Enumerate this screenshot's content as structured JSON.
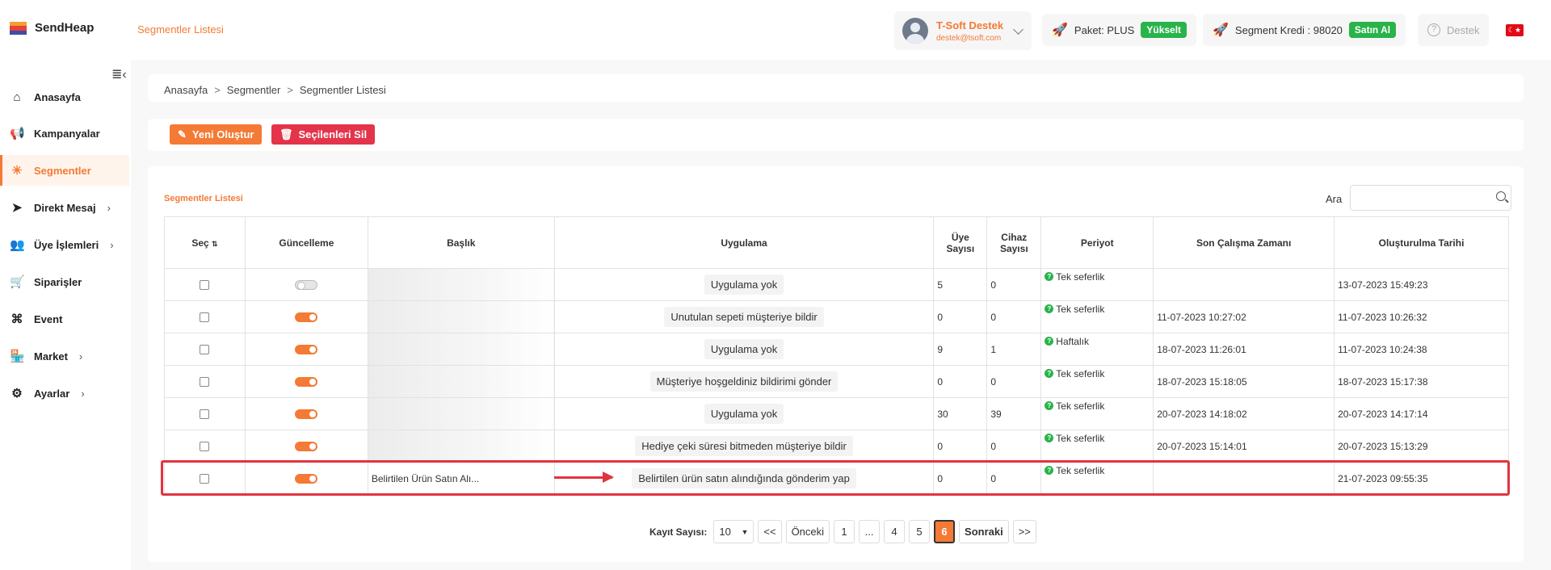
{
  "app": {
    "name": "SendHeap",
    "page_heading": "Segmentler Listesi"
  },
  "user": {
    "name": "T-Soft Destek",
    "email": "destek@tsoft.com"
  },
  "topbar": {
    "package_label": "Paket: PLUS",
    "upgrade_label": "Yükselt",
    "credit_label": "Segment Kredi : 98020",
    "buy_label": "Satın Al",
    "support_label": "Destek",
    "language": "TR"
  },
  "sidebar": {
    "items": [
      {
        "label": "Anasayfa",
        "icon": "home-icon",
        "glyph": "⌂",
        "chevron": ""
      },
      {
        "label": "Kampanyalar",
        "icon": "megaphone-icon",
        "glyph": "📢",
        "chevron": ""
      },
      {
        "label": "Segmentler",
        "icon": "segments-icon",
        "glyph": "✳",
        "chevron": ""
      },
      {
        "label": "Direkt Mesaj",
        "icon": "send-icon",
        "glyph": "➤",
        "chevron": "›"
      },
      {
        "label": "Üye İşlemleri",
        "icon": "users-icon",
        "glyph": "👥",
        "chevron": "›"
      },
      {
        "label": "Siparişler",
        "icon": "cart-icon",
        "glyph": "🛒",
        "chevron": ""
      },
      {
        "label": "Event",
        "icon": "command-icon",
        "glyph": "⌘",
        "chevron": ""
      },
      {
        "label": "Market",
        "icon": "store-icon",
        "glyph": "🏪",
        "chevron": "›"
      },
      {
        "label": "Ayarlar",
        "icon": "gear-icon",
        "glyph": "⚙",
        "chevron": "›"
      }
    ]
  },
  "breadcrumb": {
    "home": "Anasayfa",
    "parent": "Segmentler",
    "current": "Segmentler Listesi"
  },
  "actions": {
    "create": "Yeni Oluştur",
    "delete_selected": "Seçilenleri Sil"
  },
  "list": {
    "title": "Segmentler Listesi",
    "search_label": "Ara",
    "search_value": ""
  },
  "table": {
    "headers": {
      "select": "Seç",
      "update": "Güncelleme",
      "title": "Başlık",
      "application": "Uygulama",
      "members_1": "Üye",
      "members_2": "Sayısı",
      "devices_1": "Cihaz",
      "devices_2": "Sayısı",
      "period": "Periyot",
      "last_run": "Son Çalışma Zamanı",
      "created": "Oluşturulma Tarihi"
    },
    "rows": [
      {
        "toggle": "off",
        "title": "",
        "app": "Uygulama yok",
        "members": "5",
        "devices": "0",
        "period": "Tek seferlik",
        "last_run": "",
        "created": "13-07-2023 15:49:23"
      },
      {
        "toggle": "on",
        "title": "",
        "app": "Unutulan sepeti müşteriye bildir",
        "members": "0",
        "devices": "0",
        "period": "Tek seferlik",
        "last_run": "11-07-2023 10:27:02",
        "created": "11-07-2023 10:26:32"
      },
      {
        "toggle": "on",
        "title": "",
        "app": "Uygulama yok",
        "members": "9",
        "devices": "1",
        "period": "Haftalık",
        "last_run": "18-07-2023 11:26:01",
        "created": "11-07-2023 10:24:38"
      },
      {
        "toggle": "on",
        "title": "",
        "app": "Müşteriye hoşgeldiniz bildirimi gönder",
        "members": "0",
        "devices": "0",
        "period": "Tek seferlik",
        "last_run": "18-07-2023 15:18:05",
        "created": "18-07-2023 15:17:38"
      },
      {
        "toggle": "on",
        "title": "",
        "app": "Uygulama yok",
        "members": "30",
        "devices": "39",
        "period": "Tek seferlik",
        "last_run": "20-07-2023 14:18:02",
        "created": "20-07-2023 14:17:14"
      },
      {
        "toggle": "on",
        "title": "",
        "app": "Hediye çeki süresi bitmeden müşteriye bildir",
        "members": "0",
        "devices": "0",
        "period": "Tek seferlik",
        "last_run": "20-07-2023 15:14:01",
        "created": "20-07-2023 15:13:29"
      },
      {
        "toggle": "on",
        "title": "Belirtilen Ürün Satın Alı...",
        "app": "Belirtilen ürün satın alındığında gönderim yap",
        "members": "0",
        "devices": "0",
        "period": "Tek seferlik",
        "last_run": "",
        "created": "21-07-2023 09:55:35"
      }
    ]
  },
  "pagination": {
    "label": "Kayıt Sayısı:",
    "page_size": "10",
    "first": "<<",
    "prev": "Önceki",
    "pages": [
      "1",
      "...",
      "4",
      "5",
      "6"
    ],
    "current": "6",
    "next": "Sonraki",
    "last": ">>"
  },
  "colors": {
    "accent": "#f47a35",
    "green": "#29b34a",
    "red": "#e3344a",
    "highlight": "#e1343f"
  }
}
